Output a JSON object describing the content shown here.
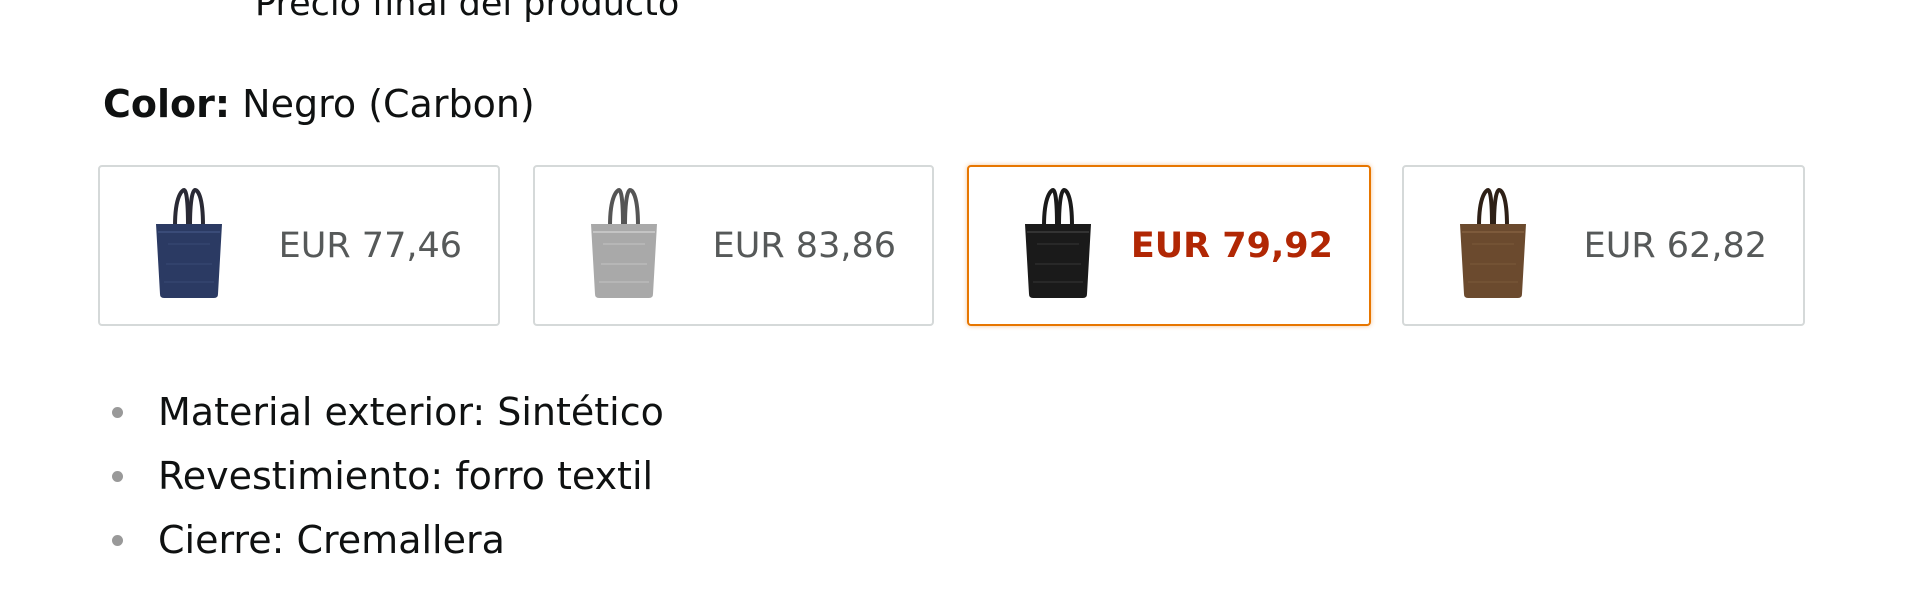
{
  "header": {
    "final_price_note": "Precio final del producto"
  },
  "color_selector": {
    "label": "Color:",
    "selected_value": "Negro (Carbon)",
    "options": [
      {
        "price": "EUR 77,46",
        "icon": "navy-tote-bag-icon",
        "color": "#2b3a63",
        "selected": false
      },
      {
        "price": "EUR 83,86",
        "icon": "grey-tote-bag-icon",
        "color": "#a9a9a9",
        "selected": false
      },
      {
        "price": "EUR 79,92",
        "icon": "black-tote-bag-icon",
        "color": "#1a1a1a",
        "selected": true
      },
      {
        "price": "EUR 62,82",
        "icon": "brown-tote-bag-icon",
        "color": "#6b4a2e",
        "selected": false
      }
    ]
  },
  "features": [
    "Material exterior: Sintético",
    "Revestimiento: forro textil",
    "Cierre: Cremallera"
  ],
  "colors": {
    "selected_border": "#e77600",
    "selected_price": "#b12704",
    "price": "#565959"
  }
}
